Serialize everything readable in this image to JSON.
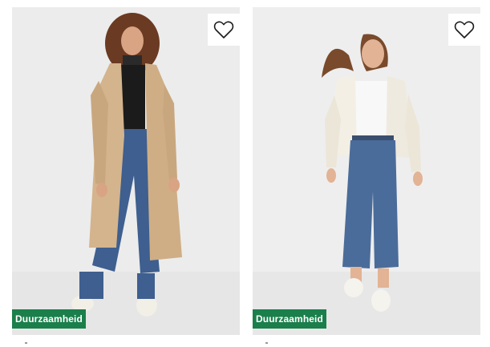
{
  "products": [
    {
      "badge": "Duurzaamheid",
      "wishlist_icon": "heart-outline-icon",
      "image": "woman-beige-trench-coat-jeans",
      "colors": {
        "background": "#ebebeb",
        "coat": "#d4b48d",
        "jeans": "#3e5f8f",
        "badge": "#1a7f4b"
      }
    },
    {
      "badge": "Duurzaamheid",
      "wishlist_icon": "heart-outline-icon",
      "image": "woman-cream-jacket-cropped-jeans",
      "colors": {
        "background": "#ebebeb",
        "jacket": "#f3efe4",
        "jeans": "#4a6c9a",
        "badge": "#1a7f4b"
      }
    }
  ]
}
